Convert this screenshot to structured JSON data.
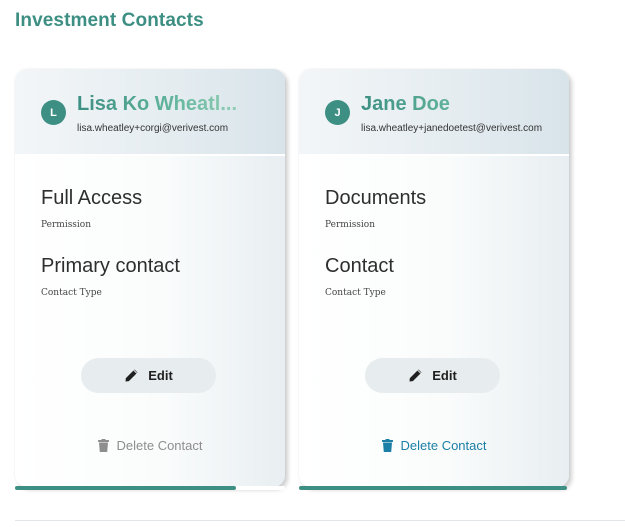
{
  "page": {
    "title": "Investment Contacts"
  },
  "contacts": [
    {
      "initial": "L",
      "name": "Lisa Ko Wheatl...",
      "email": "lisa.wheatley+corgi@verivest.com",
      "permission_value": "Full Access",
      "permission_label": "Permission",
      "contact_type_value": "Primary contact",
      "contact_type_label": "Contact Type",
      "edit_label": "Edit",
      "delete_label": "Delete Contact",
      "delete_enabled": false,
      "progress": 0.82
    },
    {
      "initial": "J",
      "name": "Jane Doe",
      "email": "lisa.wheatley+janedoetest@verivest.com",
      "permission_value": "Documents",
      "permission_label": "Permission",
      "contact_type_value": "Contact",
      "contact_type_label": "Contact Type",
      "edit_label": "Edit",
      "delete_label": "Delete Contact",
      "delete_enabled": true,
      "progress": 1.0
    }
  ],
  "icons": {
    "edit": "pencil-icon",
    "delete": "trash-icon"
  },
  "colors": {
    "accent": "#3d8f83",
    "link": "#1b7fa6",
    "disabled": "#8e8e8e",
    "button_bg": "#e7ecef"
  }
}
